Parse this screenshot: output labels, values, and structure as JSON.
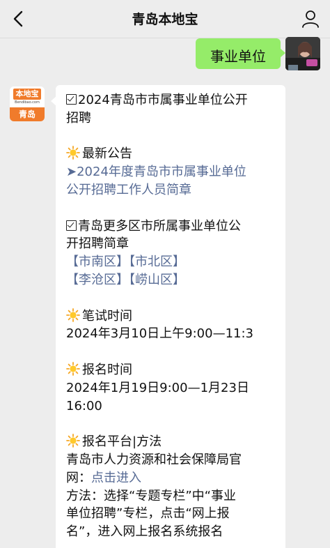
{
  "header": {
    "title": "青岛本地宝"
  },
  "my_message": {
    "text": "事业单位"
  },
  "bot_avatar": {
    "logo_main": "本地宝",
    "logo_sub": "Bendibao.com",
    "logo_city": "青岛"
  },
  "reply": {
    "l1": "2024青岛市市属事业单位公开",
    "l2": "招聘",
    "l3": "最新公告",
    "l4": "➤2024年度青岛市市属事业单位",
    "l5": "公开招聘工作人员简章",
    "l6": "青岛更多区市所属事业单位公",
    "l7": "开招聘简章",
    "l8a": "【市南区】",
    "l8b": "【市北区】",
    "l9a": "【李沧区】",
    "l9b": "【崂山区】",
    "l10": "笔试时间",
    "l11": "2024年3月10日上午9:00—11:3",
    "l12": "报名时间",
    "l13": "2024年1月19日9:00—1月23日",
    "l14": "16:00",
    "l15": "报名平台|方法",
    "l16": "青岛市人力资源和社会保障局官",
    "l17a": "网：",
    "l17b": "点击进入",
    "l18": "方法：选择“专题专栏”中“事业",
    "l19": "单位招聘”专栏，点击“网上报",
    "l20": "名”，进入网上报名系统报名"
  },
  "colors": {
    "link": "#576b95",
    "my_bubble": "#95ec69",
    "brand_orange": "#f07b2b"
  },
  "icons": [
    "back-chevron-icon",
    "profile-icon",
    "sun-emoji-icon",
    "checkbox-icon"
  ]
}
